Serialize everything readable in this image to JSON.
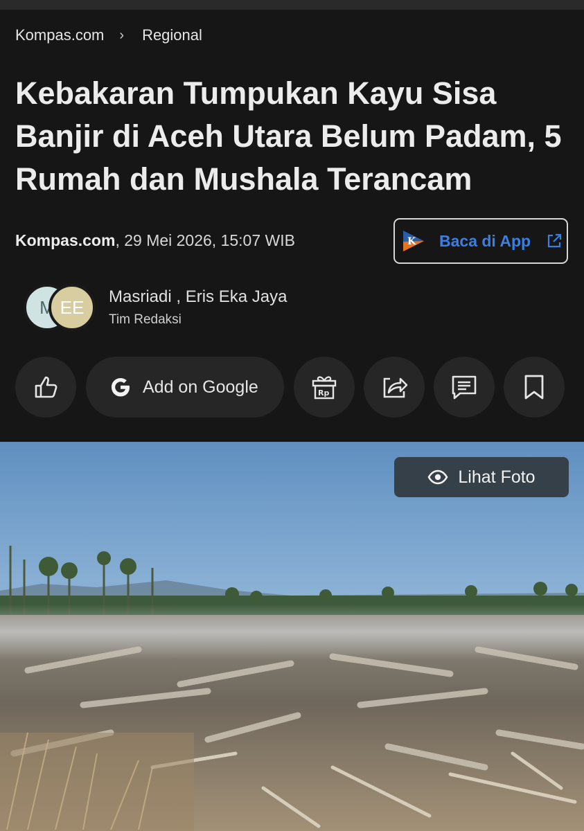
{
  "breadcrumb": {
    "site": "Kompas.com",
    "section": "Regional"
  },
  "article": {
    "title": "Kebakaran Tumpukan Kayu Sisa Banjir di Aceh Utara Belum Padam, 5 Rumah dan Mushala Terancam",
    "source": "Kompas.com",
    "date": ", 29 Mei 2026, 15:07 WIB"
  },
  "app_button": {
    "label": "Baca di App",
    "icon_letter": "K"
  },
  "authors": {
    "names": "Masriadi ,  Eris Eka Jaya",
    "team": "Tim Redaksi",
    "avatar1_initial": "M",
    "avatar2_initials": "EE"
  },
  "actions": {
    "google_label": "Add on Google"
  },
  "photo": {
    "view_label": "Lihat Foto"
  },
  "colors": {
    "background": "#161616",
    "accent_blue": "#3b7fe0",
    "button_surface": "#262626"
  }
}
